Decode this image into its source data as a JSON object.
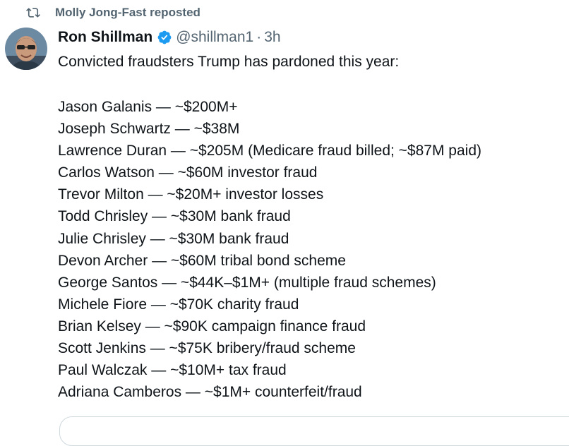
{
  "repost": {
    "label": "Molly Jong-Fast reposted",
    "icon": "repost-icon"
  },
  "tweet": {
    "author_name": "Ron Shillman",
    "handle": "@shillman1",
    "separator": "·",
    "time": "3h",
    "verified_badge_color": "#1d9bf0",
    "intro": "Convicted fraudsters Trump has pardoned this year:",
    "items": [
      "Jason Galanis — ~$200M+",
      "Joseph Schwartz — ~$38M",
      "Lawrence Duran — ~$205M (Medicare fraud billed; ~$87M paid)",
      "Carlos Watson — ~$60M investor fraud",
      "Trevor Milton — ~$20M+ investor losses",
      "Todd Chrisley — ~$30M bank fraud",
      "Julie Chrisley — ~$30M bank fraud",
      "Devon Archer — ~$60M tribal bond scheme",
      "George Santos — ~$44K–$1M+ (multiple fraud schemes)",
      "Michele Fiore — ~$70K charity fraud",
      "Brian Kelsey — ~$90K campaign finance fraud",
      "Scott Jenkins — ~$75K bribery/fraud scheme",
      "Paul Walczak — ~$10M+ tax fraud",
      "Adriana Camberos — ~$1M+ counterfeit/fraud"
    ]
  }
}
